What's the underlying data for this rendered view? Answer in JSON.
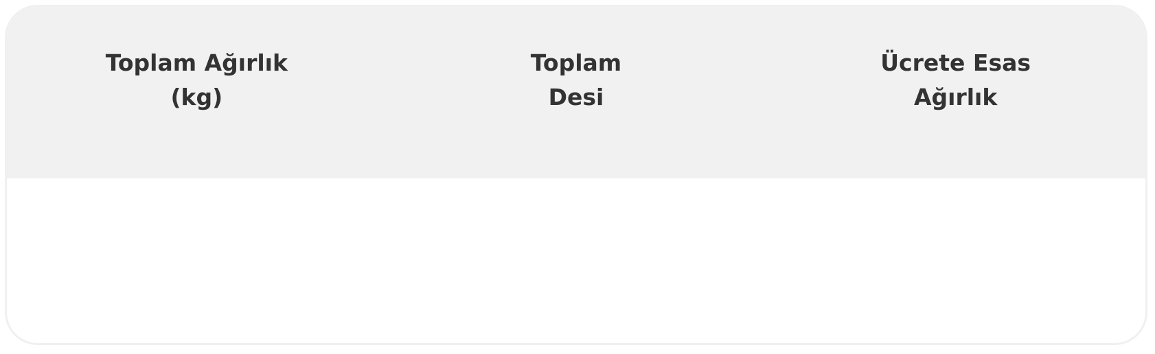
{
  "table": {
    "headers": [
      "Toplam Ağırlık (kg)",
      "Toplam Desi",
      "Ücrete Esas Ağırlık"
    ],
    "row": [
      "",
      "",
      ""
    ]
  },
  "colors": {
    "header_background": "#f1f1f1",
    "border": "#f0f0f0",
    "text": "#333333"
  }
}
